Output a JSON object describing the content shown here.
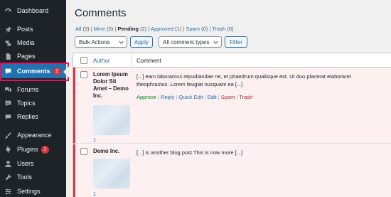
{
  "sidebar": {
    "items": [
      {
        "label": "Dashboard",
        "icon": "dashboard-icon"
      },
      {
        "label": "Posts",
        "icon": "pin-icon"
      },
      {
        "label": "Media",
        "icon": "media-icon"
      },
      {
        "label": "Pages",
        "icon": "page-icon"
      },
      {
        "label": "Comments",
        "icon": "comment-icon",
        "badge": "2",
        "active": true
      },
      {
        "label": "Forums",
        "icon": "forums-icon"
      },
      {
        "label": "Topics",
        "icon": "topics-icon"
      },
      {
        "label": "Replies",
        "icon": "replies-icon"
      },
      {
        "label": "Appearance",
        "icon": "brush-icon"
      },
      {
        "label": "Plugins",
        "icon": "plug-icon",
        "badge": "1"
      },
      {
        "label": "Users",
        "icon": "user-icon"
      },
      {
        "label": "Tools",
        "icon": "wrench-icon"
      },
      {
        "label": "Settings",
        "icon": "settings-icon"
      }
    ]
  },
  "page": {
    "title": "Comments"
  },
  "filters": {
    "all": {
      "label": "All",
      "count": "(3)"
    },
    "mine": {
      "label": "Mine",
      "count": "(0)"
    },
    "pending": {
      "label": "Pending",
      "count": "(2)"
    },
    "approved": {
      "label": "Approved",
      "count": "(1)"
    },
    "spam": {
      "label": "Spam",
      "count": "(0)"
    },
    "trash": {
      "label": "Trash",
      "count": "(0)"
    }
  },
  "toolbar": {
    "bulk_actions": "Bulk Actions",
    "apply": "Apply",
    "comment_types": "All comment types",
    "filter": "Filter"
  },
  "table": {
    "headers": {
      "author": "Author",
      "comment": "Comment"
    },
    "rows": [
      {
        "author_lines": [
          "Lorem Ipsum",
          "Dolor Sit",
          "Amet – Demo",
          "Inc."
        ],
        "author_link": "1",
        "comment_lines": [
          "[...] eam laboramus repudiandae ne, et phaedrum qualisque est. Ut duo placerat elaboraret",
          "theophrastus. Lorem feugiat nusquam ea [...]"
        ],
        "actions": {
          "approve": "Approve",
          "reply": "Reply",
          "quick_edit": "Quick Edit",
          "edit": "Edit",
          "spam": "Spam",
          "trash": "Trash"
        }
      },
      {
        "author_lines": [
          "Demo Inc."
        ],
        "author_link": "1",
        "comment_lines": [
          "[...] is another blog post This is now more [...]"
        ]
      }
    ]
  },
  "colors": {
    "sidebar_bg": "#1d2327",
    "active_bg": "#2271b1",
    "highlight": "#e1135b",
    "pending_border": "#d63638",
    "approve": "#008a20"
  }
}
